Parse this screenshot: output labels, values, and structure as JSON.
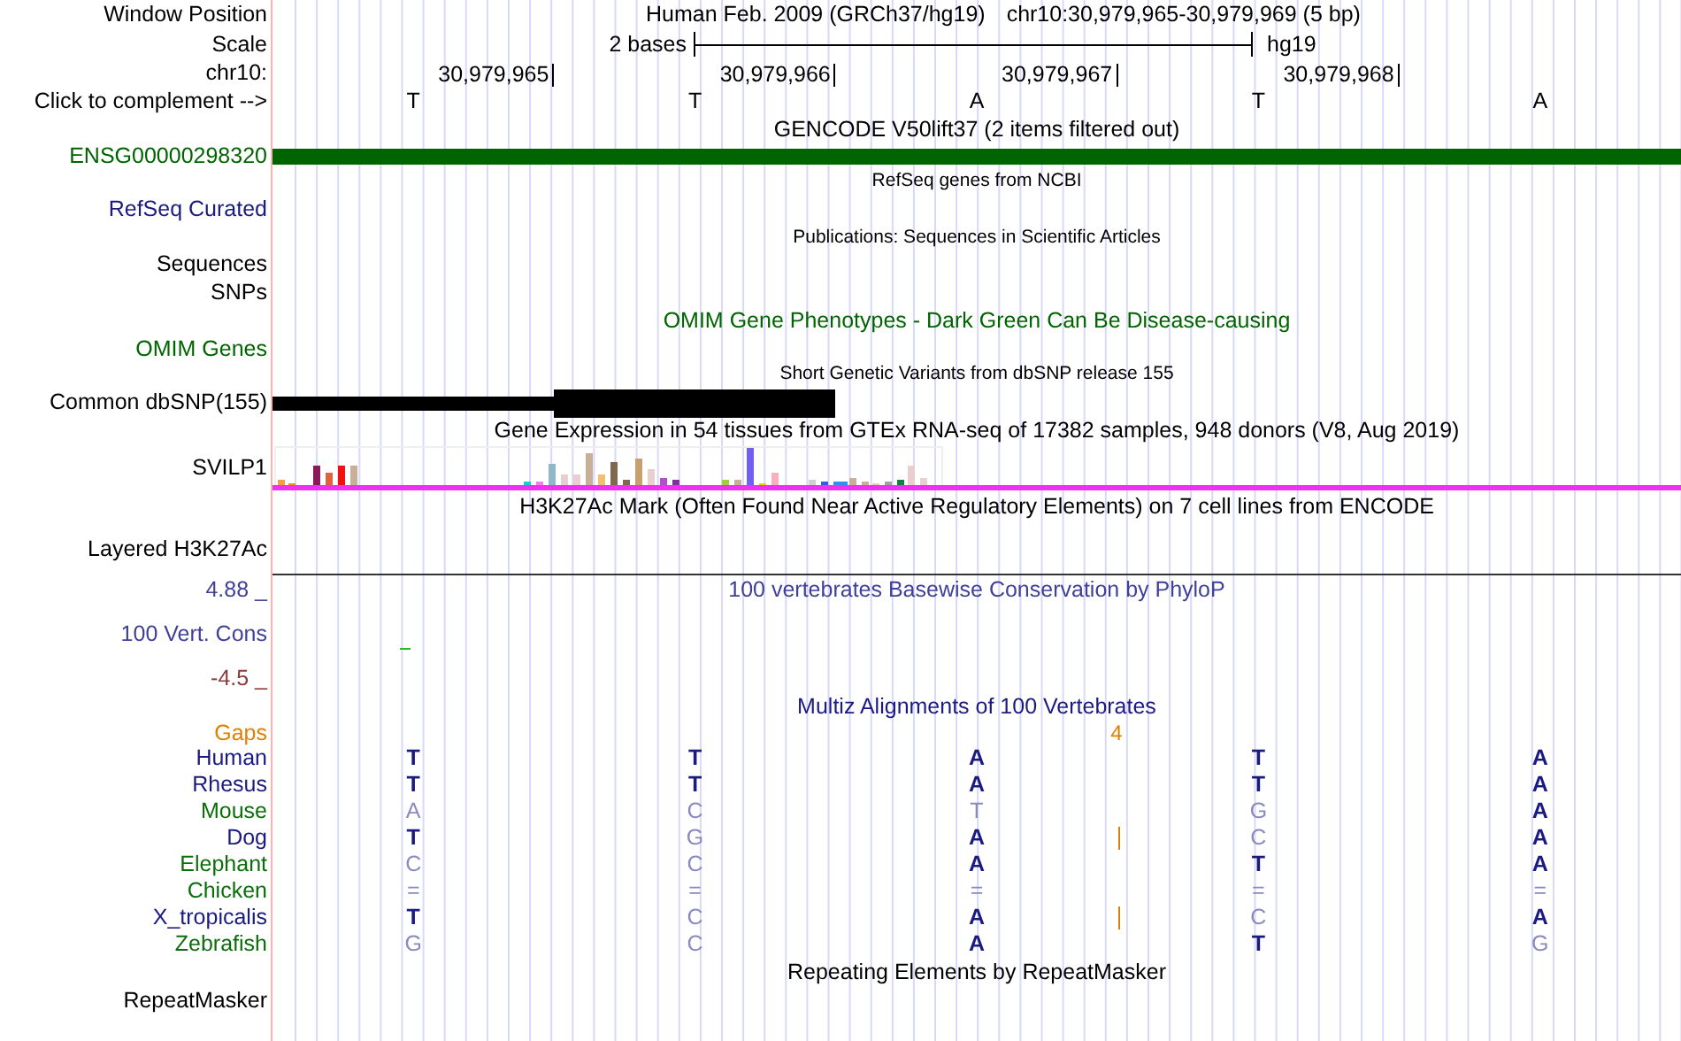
{
  "header": {
    "window_position_label": "Window Position",
    "assembly": "Human Feb. 2009 (GRCh37/hg19)",
    "position": "chr10:30,979,965-30,979,969 (5 bp)",
    "scale_label": "Scale",
    "scale_text": "2 bases",
    "scale_db": "hg19",
    "chrom_label": "chr10:",
    "ticks": [
      "30,979,965",
      "30,979,966",
      "30,979,967",
      "30,979,968"
    ],
    "complement_label": "Click to complement -->",
    "bases": [
      "T",
      "T",
      "A",
      "T",
      "A"
    ]
  },
  "gencode": {
    "title": "GENCODE V50lift37 (2 items filtered out)",
    "label": "ENSG00000298320"
  },
  "refseq": {
    "title": "RefSeq genes from NCBI",
    "label": "RefSeq Curated"
  },
  "publications": {
    "title": "Publications: Sequences in Scientific Articles",
    "labels": [
      "Sequences",
      "SNPs"
    ]
  },
  "omim": {
    "title": "OMIM Gene Phenotypes - Dark Green Can Be Disease-causing",
    "label": "OMIM Genes"
  },
  "dbsnp": {
    "title": "Short Genetic Variants from dbSNP release 155",
    "label": "Common dbSNP(155)"
  },
  "gtex": {
    "title": "Gene Expression in 54 tissues from GTEx RNA-seq of 17382 samples, 948 donors (V8, Aug 2019)",
    "label": "SVILP1"
  },
  "h3k27ac": {
    "title": "H3K27Ac Mark (Often Found Near Active Regulatory Elements) on 7 cell lines from ENCODE",
    "label": "Layered H3K27Ac"
  },
  "phylop": {
    "max": "4.88 _",
    "title": "100 vertebrates Basewise Conservation by PhyloP",
    "label": "100 Vert. Cons",
    "min": "-4.5 _"
  },
  "multiz": {
    "title": "Multiz Alignments of 100 Vertebrates",
    "gaps_label": "Gaps",
    "gap_count": "4",
    "species": [
      {
        "name": "Human",
        "color": "#1a1a80",
        "insertion": false,
        "bases": [
          {
            "text": "T",
            "match": true
          },
          {
            "text": "T",
            "match": true
          },
          {
            "text": "A",
            "match": true
          },
          {
            "text": "T",
            "match": true
          },
          {
            "text": "A",
            "match": true
          }
        ]
      },
      {
        "name": "Rhesus",
        "color": "#1a1a80",
        "insertion": false,
        "bases": [
          {
            "text": "T",
            "match": true
          },
          {
            "text": "T",
            "match": true
          },
          {
            "text": "A",
            "match": true
          },
          {
            "text": "T",
            "match": true
          },
          {
            "text": "A",
            "match": true
          }
        ]
      },
      {
        "name": "Mouse",
        "color": "#0a6e0a",
        "insertion": false,
        "bases": [
          {
            "text": "A",
            "match": false
          },
          {
            "text": "C",
            "match": false
          },
          {
            "text": "T",
            "match": false
          },
          {
            "text": "G",
            "match": false
          },
          {
            "text": "A",
            "match": true
          }
        ]
      },
      {
        "name": "Dog",
        "color": "#1a1a80",
        "insertion": true,
        "bases": [
          {
            "text": "T",
            "match": true
          },
          {
            "text": "G",
            "match": false
          },
          {
            "text": "A",
            "match": true
          },
          {
            "text": "C",
            "match": false
          },
          {
            "text": "A",
            "match": true
          }
        ]
      },
      {
        "name": "Elephant",
        "color": "#0a6e0a",
        "insertion": false,
        "bases": [
          {
            "text": "C",
            "match": false
          },
          {
            "text": "C",
            "match": false
          },
          {
            "text": "A",
            "match": true
          },
          {
            "text": "T",
            "match": true
          },
          {
            "text": "A",
            "match": true
          }
        ]
      },
      {
        "name": "Chicken",
        "color": "#0a6e0a",
        "insertion": false,
        "bases": [
          {
            "text": "=",
            "match": false
          },
          {
            "text": "=",
            "match": false
          },
          {
            "text": "=",
            "match": false
          },
          {
            "text": "=",
            "match": false
          },
          {
            "text": "=",
            "match": false
          }
        ]
      },
      {
        "name": "X_tropicalis",
        "color": "#1a1a80",
        "insertion": true,
        "bases": [
          {
            "text": "T",
            "match": true
          },
          {
            "text": "C",
            "match": false
          },
          {
            "text": "A",
            "match": true
          },
          {
            "text": "C",
            "match": false
          },
          {
            "text": "A",
            "match": true
          }
        ]
      },
      {
        "name": "Zebrafish",
        "color": "#0a6e0a",
        "insertion": false,
        "bases": [
          {
            "text": "G",
            "match": false
          },
          {
            "text": "C",
            "match": false
          },
          {
            "text": "A",
            "match": true
          },
          {
            "text": "T",
            "match": true
          },
          {
            "text": "G",
            "match": false
          }
        ]
      }
    ]
  },
  "repeatmasker": {
    "title": "Repeating Elements by RepeatMasker",
    "label": "RepeatMasker"
  }
}
